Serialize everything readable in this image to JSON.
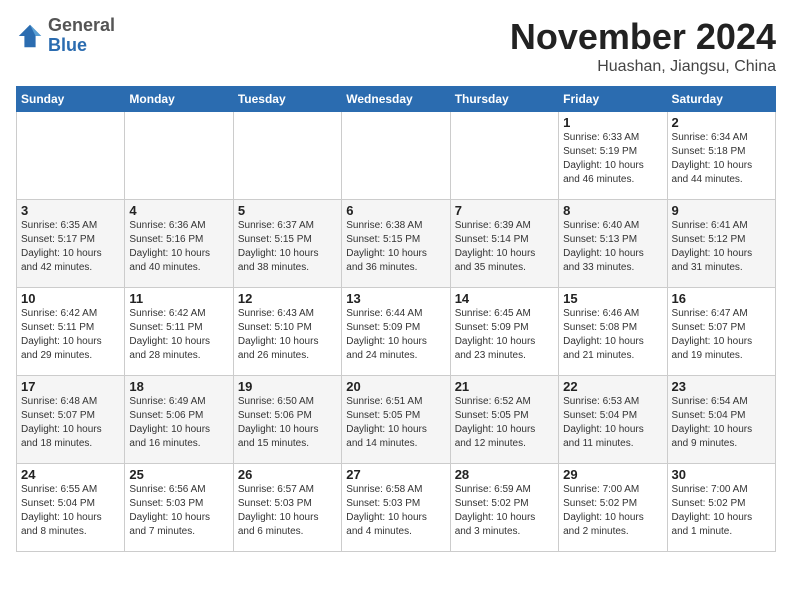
{
  "header": {
    "logo_general": "General",
    "logo_blue": "Blue",
    "month_title": "November 2024",
    "location": "Huashan, Jiangsu, China"
  },
  "calendar": {
    "weekdays": [
      "Sunday",
      "Monday",
      "Tuesday",
      "Wednesday",
      "Thursday",
      "Friday",
      "Saturday"
    ],
    "weeks": [
      [
        {
          "day": "",
          "info": ""
        },
        {
          "day": "",
          "info": ""
        },
        {
          "day": "",
          "info": ""
        },
        {
          "day": "",
          "info": ""
        },
        {
          "day": "",
          "info": ""
        },
        {
          "day": "1",
          "info": "Sunrise: 6:33 AM\nSunset: 5:19 PM\nDaylight: 10 hours\nand 46 minutes."
        },
        {
          "day": "2",
          "info": "Sunrise: 6:34 AM\nSunset: 5:18 PM\nDaylight: 10 hours\nand 44 minutes."
        }
      ],
      [
        {
          "day": "3",
          "info": "Sunrise: 6:35 AM\nSunset: 5:17 PM\nDaylight: 10 hours\nand 42 minutes."
        },
        {
          "day": "4",
          "info": "Sunrise: 6:36 AM\nSunset: 5:16 PM\nDaylight: 10 hours\nand 40 minutes."
        },
        {
          "day": "5",
          "info": "Sunrise: 6:37 AM\nSunset: 5:15 PM\nDaylight: 10 hours\nand 38 minutes."
        },
        {
          "day": "6",
          "info": "Sunrise: 6:38 AM\nSunset: 5:15 PM\nDaylight: 10 hours\nand 36 minutes."
        },
        {
          "day": "7",
          "info": "Sunrise: 6:39 AM\nSunset: 5:14 PM\nDaylight: 10 hours\nand 35 minutes."
        },
        {
          "day": "8",
          "info": "Sunrise: 6:40 AM\nSunset: 5:13 PM\nDaylight: 10 hours\nand 33 minutes."
        },
        {
          "day": "9",
          "info": "Sunrise: 6:41 AM\nSunset: 5:12 PM\nDaylight: 10 hours\nand 31 minutes."
        }
      ],
      [
        {
          "day": "10",
          "info": "Sunrise: 6:42 AM\nSunset: 5:11 PM\nDaylight: 10 hours\nand 29 minutes."
        },
        {
          "day": "11",
          "info": "Sunrise: 6:42 AM\nSunset: 5:11 PM\nDaylight: 10 hours\nand 28 minutes."
        },
        {
          "day": "12",
          "info": "Sunrise: 6:43 AM\nSunset: 5:10 PM\nDaylight: 10 hours\nand 26 minutes."
        },
        {
          "day": "13",
          "info": "Sunrise: 6:44 AM\nSunset: 5:09 PM\nDaylight: 10 hours\nand 24 minutes."
        },
        {
          "day": "14",
          "info": "Sunrise: 6:45 AM\nSunset: 5:09 PM\nDaylight: 10 hours\nand 23 minutes."
        },
        {
          "day": "15",
          "info": "Sunrise: 6:46 AM\nSunset: 5:08 PM\nDaylight: 10 hours\nand 21 minutes."
        },
        {
          "day": "16",
          "info": "Sunrise: 6:47 AM\nSunset: 5:07 PM\nDaylight: 10 hours\nand 19 minutes."
        }
      ],
      [
        {
          "day": "17",
          "info": "Sunrise: 6:48 AM\nSunset: 5:07 PM\nDaylight: 10 hours\nand 18 minutes."
        },
        {
          "day": "18",
          "info": "Sunrise: 6:49 AM\nSunset: 5:06 PM\nDaylight: 10 hours\nand 16 minutes."
        },
        {
          "day": "19",
          "info": "Sunrise: 6:50 AM\nSunset: 5:06 PM\nDaylight: 10 hours\nand 15 minutes."
        },
        {
          "day": "20",
          "info": "Sunrise: 6:51 AM\nSunset: 5:05 PM\nDaylight: 10 hours\nand 14 minutes."
        },
        {
          "day": "21",
          "info": "Sunrise: 6:52 AM\nSunset: 5:05 PM\nDaylight: 10 hours\nand 12 minutes."
        },
        {
          "day": "22",
          "info": "Sunrise: 6:53 AM\nSunset: 5:04 PM\nDaylight: 10 hours\nand 11 minutes."
        },
        {
          "day": "23",
          "info": "Sunrise: 6:54 AM\nSunset: 5:04 PM\nDaylight: 10 hours\nand 9 minutes."
        }
      ],
      [
        {
          "day": "24",
          "info": "Sunrise: 6:55 AM\nSunset: 5:04 PM\nDaylight: 10 hours\nand 8 minutes."
        },
        {
          "day": "25",
          "info": "Sunrise: 6:56 AM\nSunset: 5:03 PM\nDaylight: 10 hours\nand 7 minutes."
        },
        {
          "day": "26",
          "info": "Sunrise: 6:57 AM\nSunset: 5:03 PM\nDaylight: 10 hours\nand 6 minutes."
        },
        {
          "day": "27",
          "info": "Sunrise: 6:58 AM\nSunset: 5:03 PM\nDaylight: 10 hours\nand 4 minutes."
        },
        {
          "day": "28",
          "info": "Sunrise: 6:59 AM\nSunset: 5:02 PM\nDaylight: 10 hours\nand 3 minutes."
        },
        {
          "day": "29",
          "info": "Sunrise: 7:00 AM\nSunset: 5:02 PM\nDaylight: 10 hours\nand 2 minutes."
        },
        {
          "day": "30",
          "info": "Sunrise: 7:00 AM\nSunset: 5:02 PM\nDaylight: 10 hours\nand 1 minute."
        }
      ]
    ]
  }
}
